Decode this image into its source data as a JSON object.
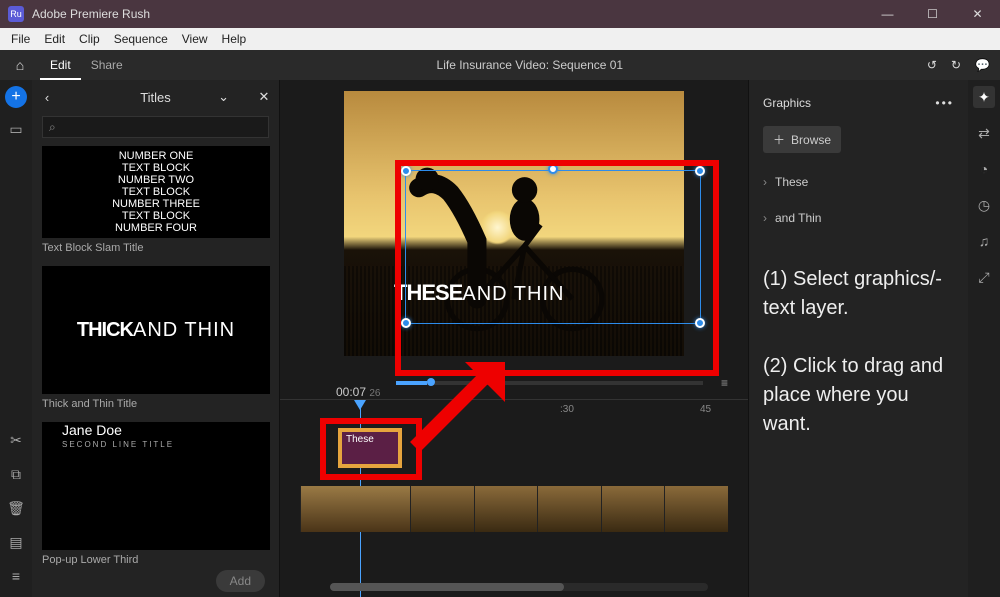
{
  "window": {
    "app_name": "Adobe Premiere Rush"
  },
  "menu": {
    "file": "File",
    "edit": "Edit",
    "clip": "Clip",
    "sequence": "Sequence",
    "view": "View",
    "help": "Help"
  },
  "appbar": {
    "edit": "Edit",
    "share": "Share",
    "title": "Life Insurance Video: Sequence 01"
  },
  "panel": {
    "title": "Titles",
    "items": [
      {
        "caption": "Text Block Slam Title",
        "lines": [
          "NUMBER ONE",
          "TEXT BLOCK",
          "NUMBER TWO",
          "TEXT BLOCK",
          "NUMBER THREE",
          "TEXT BLOCK",
          "NUMBER FOUR"
        ]
      },
      {
        "caption": "Thick and Thin Title",
        "bold": "THICK",
        "thin": "AND THIN"
      },
      {
        "caption": "Pop-up Lower Third",
        "name": "Jane Doe",
        "sub": "SECOND LINE TITLE"
      }
    ],
    "add": "Add"
  },
  "preview": {
    "bold": "THESE",
    "thin": "AND THIN",
    "timecode": "00:07",
    "frames": "26",
    "clock": "00:00:07:26"
  },
  "timeline": {
    "marks": [
      ":30",
      "45"
    ],
    "title_clip": "These"
  },
  "graphics": {
    "heading": "Graphics",
    "browse": "Browse",
    "sections": [
      "These",
      "and Thin"
    ],
    "instructions": "(1) Select graphics/­text layer.\n\n(2) Click to drag and place where you want."
  }
}
